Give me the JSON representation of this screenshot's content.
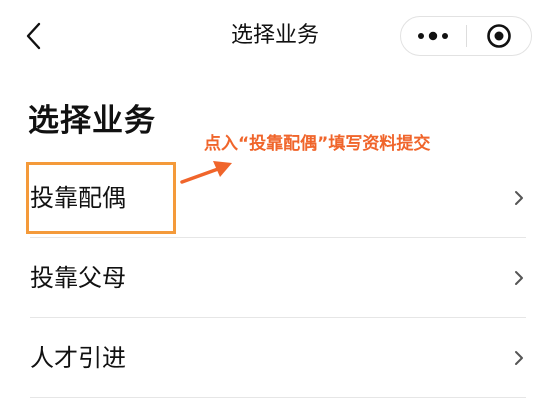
{
  "nav": {
    "title": "选择业务",
    "back_icon": "chevron-left-icon",
    "more_icon": "more-dots-icon",
    "close_icon": "target-circle-icon"
  },
  "page": {
    "heading": "选择业务"
  },
  "annotation": {
    "text": "点入“投靠配偶”填写资料提交",
    "color": "#f0652b",
    "highlight_color": "#f49a3a"
  },
  "items": [
    {
      "label": "投靠配偶",
      "icon": "chevron-right-icon"
    },
    {
      "label": "投靠父母",
      "icon": "chevron-right-icon"
    },
    {
      "label": "人才引进",
      "icon": "chevron-right-icon"
    }
  ]
}
